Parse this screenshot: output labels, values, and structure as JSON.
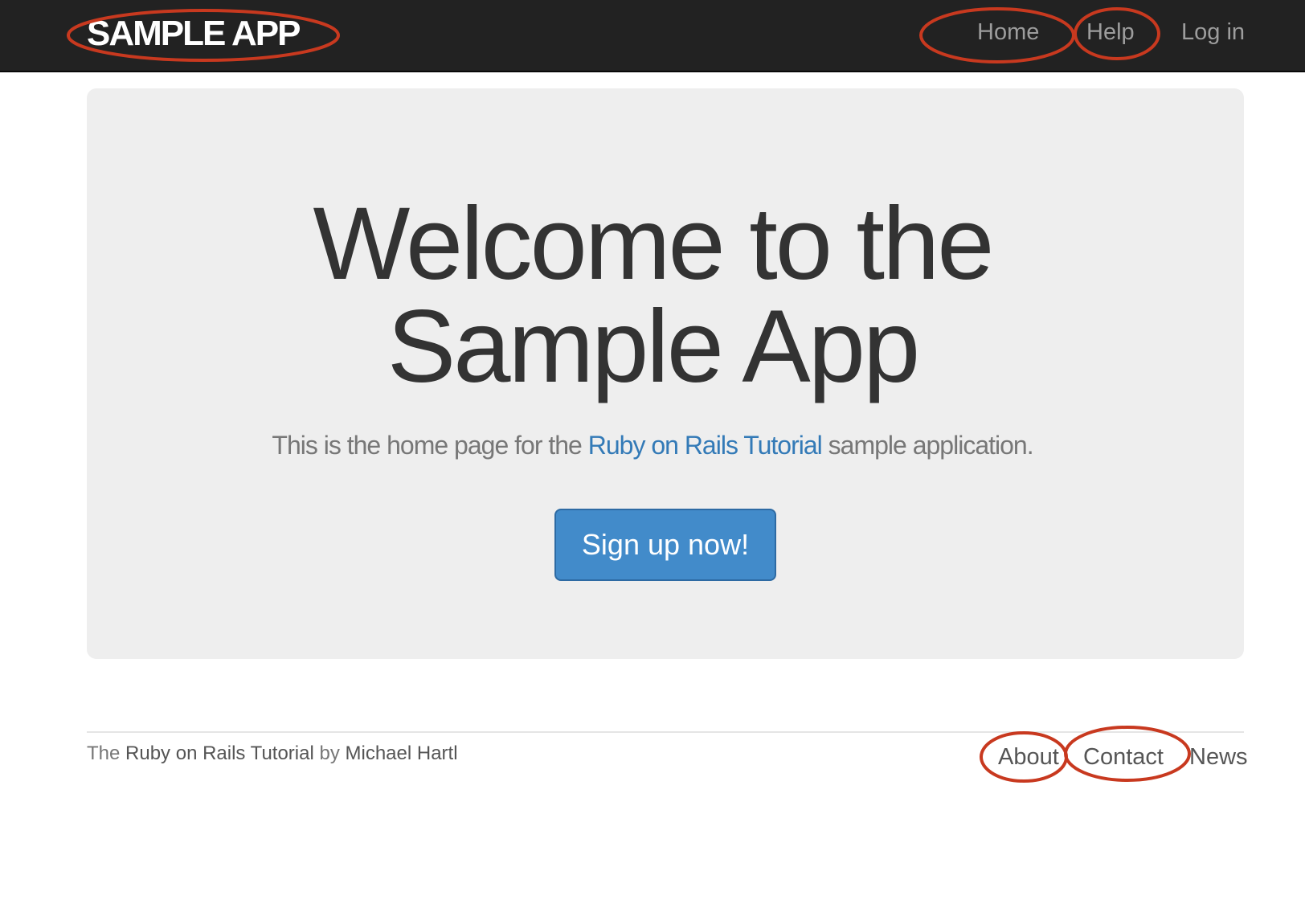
{
  "navbar": {
    "logo": "SAMPLE APP",
    "links": {
      "home": "Home",
      "help": "Help",
      "login": "Log in"
    }
  },
  "hero": {
    "title_line1": "Welcome to the",
    "title_line2": "Sample App",
    "subtitle_before": "This is the home page for the ",
    "subtitle_link": "Ruby on Rails Tutorial",
    "subtitle_after": " sample application.",
    "signup_button": "Sign up now!"
  },
  "footer": {
    "prefix": "The ",
    "tutorial_link": "Ruby on Rails Tutorial",
    "by": " by ",
    "author_link": "Michael Hartl",
    "links": {
      "about": "About",
      "contact": "Contact",
      "news": "News"
    }
  },
  "colors": {
    "navbar_bg": "#222222",
    "annotation_red": "#c8391f",
    "button_blue": "#428bca",
    "link_blue": "#337ab7",
    "jumbotron_bg": "#eeeeee"
  }
}
